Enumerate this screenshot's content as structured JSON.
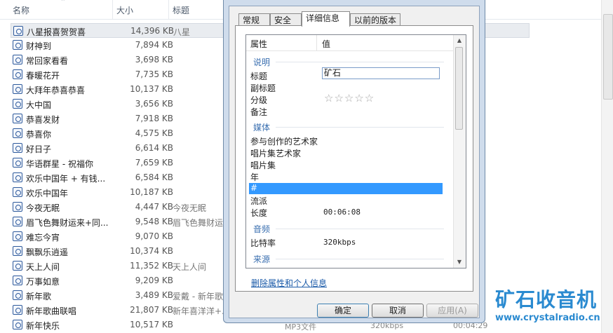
{
  "explorer": {
    "columns": {
      "name": "名称",
      "size": "大小",
      "title": "标题"
    },
    "files": [
      {
        "name": "八星报喜贺贺喜",
        "size": "14,396 KB",
        "title": "八星"
      },
      {
        "name": "财神到",
        "size": "7,894 KB",
        "title": ""
      },
      {
        "name": "常回家看看",
        "size": "3,698 KB",
        "title": ""
      },
      {
        "name": "春暖花开",
        "size": "7,735 KB",
        "title": ""
      },
      {
        "name": "大拜年恭喜恭喜",
        "size": "10,137 KB",
        "title": ""
      },
      {
        "name": "大中国",
        "size": "3,656 KB",
        "title": ""
      },
      {
        "name": "恭喜发财",
        "size": "7,918 KB",
        "title": ""
      },
      {
        "name": "恭喜你",
        "size": "4,575 KB",
        "title": ""
      },
      {
        "name": "好日子",
        "size": "6,614 KB",
        "title": ""
      },
      {
        "name": "华语群星 - 祝福你",
        "size": "7,659 KB",
        "title": ""
      },
      {
        "name": "欢乐中国年 + 有钱...",
        "size": "6,584 KB",
        "title": ""
      },
      {
        "name": "欢乐中国年",
        "size": "10,187 KB",
        "title": ""
      },
      {
        "name": "今夜无眠",
        "size": "4,447 KB",
        "title": "今夜无眠"
      },
      {
        "name": "眉飞色舞财运来+同...",
        "size": "9,548 KB",
        "title": "眉飞色舞财运"
      },
      {
        "name": "难忘今宵",
        "size": "9,070 KB",
        "title": ""
      },
      {
        "name": "飘飘乐逍遥",
        "size": "10,374 KB",
        "title": ""
      },
      {
        "name": "天上人间",
        "size": "11,352 KB",
        "title": "天上人间"
      },
      {
        "name": "万事如意",
        "size": "9,209 KB",
        "title": ""
      },
      {
        "name": "新年歌",
        "size": "3,489 KB",
        "title": "爱戴 - 新年歌"
      },
      {
        "name": "新年歌曲联唱",
        "size": "21,807 KB",
        "title": "新年喜洋洋+..."
      },
      {
        "name": "新年快乐",
        "size": "10,517 KB",
        "title": ""
      }
    ],
    "last_row_extra": {
      "type": "MP3文件",
      "bitrate": "320kbps",
      "duration": "00:04:29"
    }
  },
  "dialog": {
    "tabs": [
      {
        "label": "常规"
      },
      {
        "label": "安全"
      },
      {
        "label": "详细信息"
      },
      {
        "label": "以前的版本"
      }
    ],
    "prop_header": {
      "name": "属性",
      "value": "值"
    },
    "groups": {
      "desc": "说明",
      "media": "媒体",
      "audio": "音频",
      "origin": "来源"
    },
    "props": {
      "title_label": "标题",
      "title_value": "矿石",
      "subtitle_label": "副标题",
      "rating_label": "分级",
      "rating_stars": "☆☆☆☆☆",
      "comment_label": "备注",
      "contributing_label": "参与创作的艺术家",
      "album_artist_label": "唱片集艺术家",
      "album_label": "唱片集",
      "year_label": "年",
      "track_label": "#",
      "genre_label": "流派",
      "length_label": "长度",
      "length_value": "00:06:08",
      "bitrate_label": "比特率",
      "bitrate_value": "320kbps"
    },
    "remove_link": "删除属性和个人信息",
    "buttons": {
      "ok": "确定",
      "cancel": "取消",
      "apply": "应用(A)"
    }
  },
  "watermark": {
    "title": "矿石收音机",
    "url": "www.crystalradio.cn"
  },
  "colors": {
    "accent": "#3399ff",
    "group_text": "#3a6fb0",
    "watermark": "#2a8ad0"
  }
}
